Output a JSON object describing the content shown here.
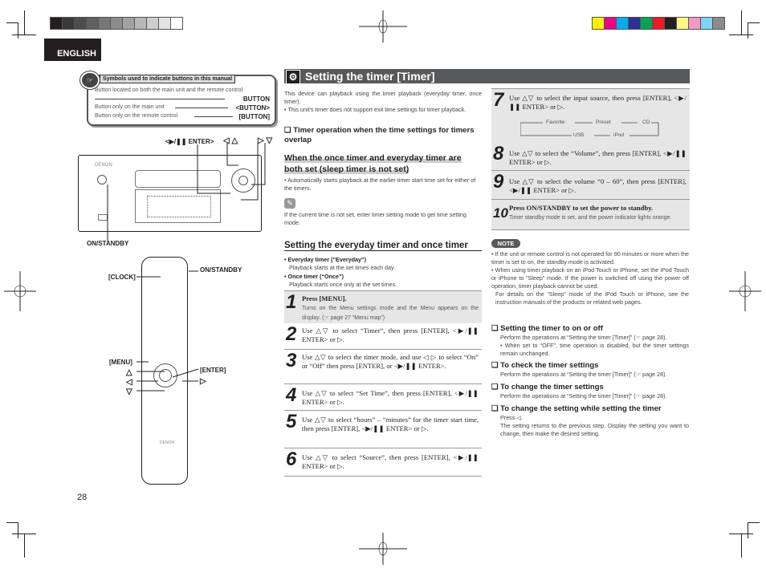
{
  "page": {
    "language_tab": "ENGLISH",
    "page_number": "28",
    "gray_swatches": [
      "#231f20",
      "#3a3838",
      "#4d4d4d",
      "#606060",
      "#777777",
      "#8c8c8c",
      "#a2a2a2",
      "#b7b7b7",
      "#cdcdcd",
      "#e4e4e4",
      "#ffffff"
    ],
    "color_swatches": [
      "#fff200",
      "#ec008c",
      "#00aeef",
      "#2e3192",
      "#00a651",
      "#ed1c24",
      "#231f20",
      "#fff685",
      "#f49ac1",
      "#7fd4f5",
      "#8c8c8c"
    ]
  },
  "legend": {
    "title": "Symbols used to indicate buttons in this manual",
    "rows": [
      {
        "text": "Button located on both the main unit and the remote control",
        "key": "BUTTON"
      },
      {
        "text": "Button only on the main unit",
        "key": "<BUTTON>"
      },
      {
        "text": "Button only on the remote control",
        "key": "[BUTTON]"
      }
    ]
  },
  "illustrations": {
    "main_unit": {
      "brand": "DENON",
      "callouts": {
        "enter": "<▶/❚❚ ENTER>",
        "left_up": "◁ △",
        "right_down": "▷ ▽",
        "on_standby": "ON/STANDBY"
      }
    },
    "remote": {
      "brand": "DENON",
      "callouts": {
        "clock": "[CLOCK]",
        "on_standby": "ON/STANDBY",
        "menu": "[MENU]",
        "up": "△",
        "left": "◁",
        "down": "▽",
        "enter": "[ENTER]",
        "right": "▷"
      }
    }
  },
  "main": {
    "title": "Setting the timer [Timer]",
    "intro": "This device can playback using the timer playback (everyday timer, once timer).",
    "intro_bullet": "• This unit's timer does not support exit time settings for timer playback.",
    "overlap_heading": "❏ Timer operation when the time settings for timers overlap",
    "both_set_heading": "When the once timer and everyday timer are both set (sleep timer is not set)",
    "both_set_bullet": "• Automatically starts playback at the earlier timer start time set for either of the timers.",
    "memo_text": "If the current time is not set, enter timer setting mode to get time setting mode.",
    "section_heading": "Setting the everyday timer and once timer",
    "everyday_label": "• Everyday timer (“Everyday”)",
    "everyday_desc": "Playback starts at the set times each day.",
    "once_label": "• Once timer (“Once”)",
    "once_desc": "Playback starts once only at the set times.",
    "steps": [
      {
        "num": "1",
        "title": "Press [MENU].",
        "sub": "Turns on the Menu settings mode and the Menu appears on the display. (☞ page 27 “Menu map”)"
      },
      {
        "num": "2",
        "text": "Use △▽ to select “Timer”, then press [ENTER], <▶/❚❚ ENTER> or ▷."
      },
      {
        "num": "3",
        "text": "Use △▽ to select the timer mode, and use ◁ ▷ to select “On” or “Off” then press [ENTER], or <▶/❚❚ ENTER>."
      },
      {
        "num": "4",
        "text": "Use △▽ to select “Set Time”, then press [ENTER], <▶/❚❚ ENTER> or ▷."
      },
      {
        "num": "5",
        "text": "Use △▽ to select “hours” – “minutes” for the timer start time, then press [ENTER], <▶/❚❚ ENTER> or ▷."
      },
      {
        "num": "6",
        "text": "Use △▽ to select “Source”, then press [ENTER], <▶/❚❚ ENTER> or ▷."
      },
      {
        "num": "7",
        "text": "Use △▽ to select the input source, then press [ENTER], <▶/❚❚ ENTER> or ▷."
      },
      {
        "num": "8",
        "text": "Use △▽ to select the “Volume”, then press [ENTER], <▶/❚❚ ENTER> or ▷."
      },
      {
        "num": "9",
        "text": "Use △▽ to select the volume “0 – 60”, then press [ENTER], <▶/❚❚ ENTER> or ▷."
      },
      {
        "num": "10",
        "title": "Press ON/STANDBY to set the power to standby.",
        "sub": "Timer standby mode is set, and the power indicator lights orange."
      }
    ],
    "source_cycle": [
      "Favorite",
      "Preset",
      "CD",
      "iPod",
      "USB"
    ]
  },
  "note": {
    "badge": "NOTE",
    "bullets": [
      "• If the unit or remote control is not operated for 90 minutes or more when the timer is set to on, the standby mode is activated.",
      "• When using timer playback on an iPod Touch or iPhone, set the iPod Touch or iPhone to “Sleep” mode. If the power is switched off using the power off operation, timer playback cannot be used.",
      "For details on the “Sleep” mode of the iPod Touch or iPhone, see the instruction manuals of the products or related web pages."
    ]
  },
  "subsections": [
    {
      "heading": "❏ Setting the timer to on or off",
      "text": "Perform the operations at “Setting the timer [Timer]” (☞ page 28).",
      "bullet": "• When set to “OFF”, time operation is disabled, but the timer settings remain unchanged."
    },
    {
      "heading": "❏ To check the timer settings",
      "text": "Perform the operations at “Setting the timer [Timer]” (☞ page 28)."
    },
    {
      "heading": "❏ To change the timer settings",
      "text": "Perform the operations at “Setting the timer [Timer]” (☞ page 28)."
    },
    {
      "heading": "❏ To change the setting while setting the timer",
      "text": "Press ◁.",
      "text2": "The setting returns to the previous step. Display the setting you want to change, then make the desired setting."
    }
  ]
}
